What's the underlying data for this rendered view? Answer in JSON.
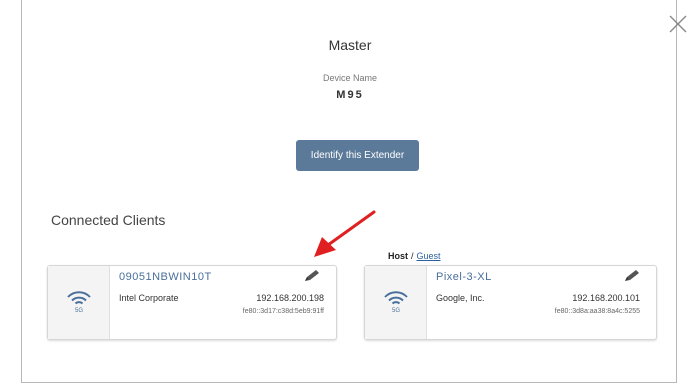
{
  "dialog": {
    "title": "Master",
    "device_name_label": "Device Name",
    "device_name_value": "M95",
    "identify_button": "Identify this Extender"
  },
  "clients_section": {
    "title": "Connected Clients",
    "filter": {
      "host": "Host",
      "separator": "/",
      "guest": "Guest",
      "active": "Host"
    },
    "clients": [
      {
        "name": "09051NBWIN10T",
        "vendor": "Intel Corporate",
        "ip": "192.168.200.198",
        "ipv6": "fe80::3d17:c38d:5eb9:91ff",
        "band": "5G",
        "icon": "wifi-5g-icon"
      },
      {
        "name": "Pixel-3-XL",
        "vendor": "Google, Inc.",
        "ip": "192.168.200.101",
        "ipv6": "fe80::3d8a:aa38:8a4c:5255",
        "band": "5G",
        "icon": "wifi-5g-icon"
      }
    ]
  },
  "colors": {
    "button": "#5b7a99",
    "client_name": "#4a6f9b",
    "annotation_arrow": "#e02020"
  }
}
